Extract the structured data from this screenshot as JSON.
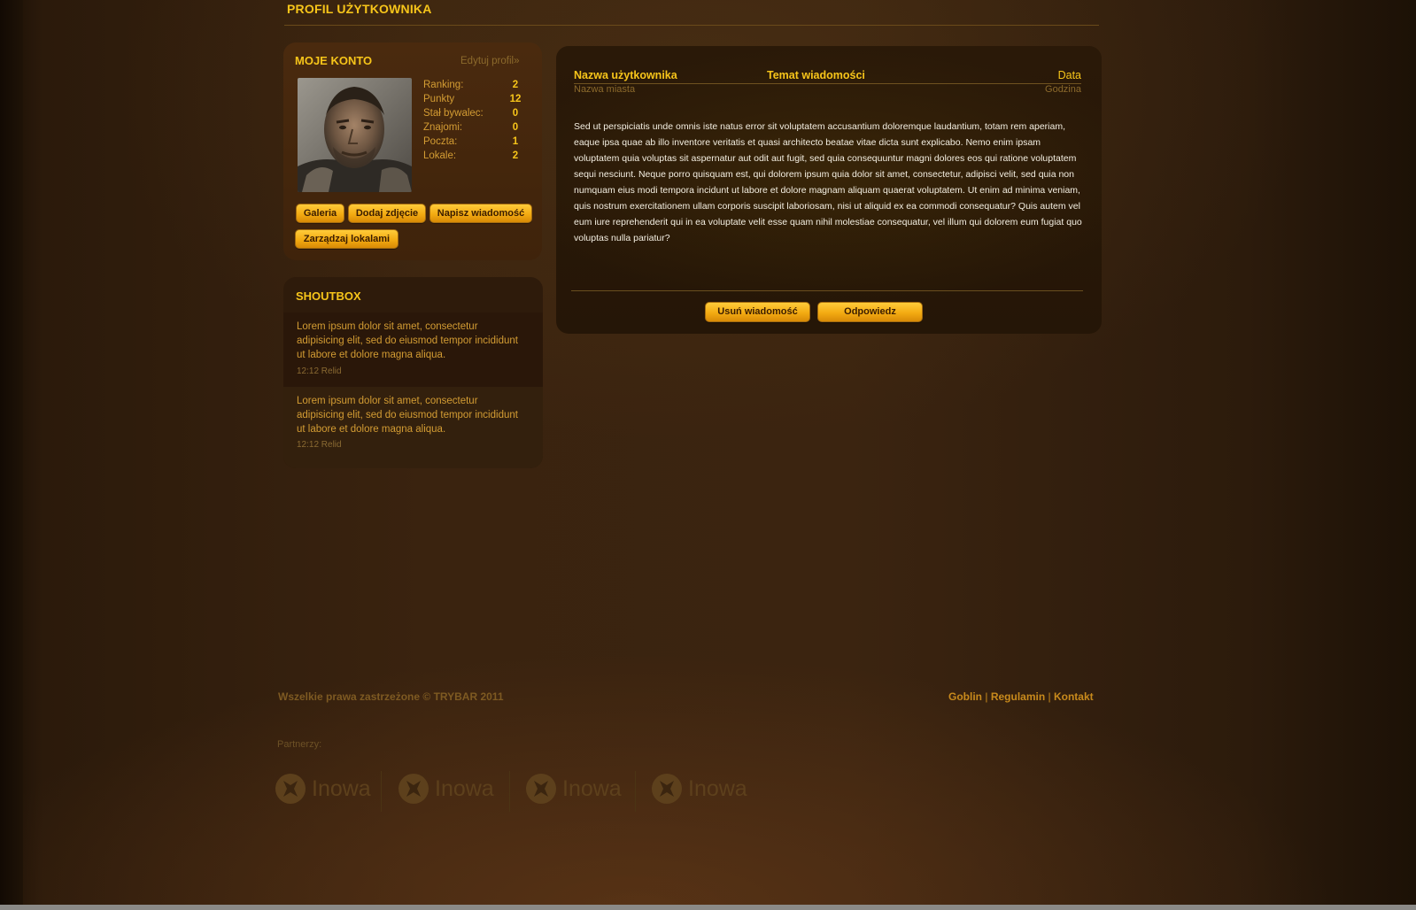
{
  "header": {
    "title": "PROFIL UŻYTKOWNIKA"
  },
  "account": {
    "heading": "MOJE KONTO",
    "edit_link": "Edytuj profil»",
    "avatar": "avatar-photo",
    "stats": [
      {
        "label": "Ranking:",
        "value": "2"
      },
      {
        "label": "Punkty",
        "value": "12"
      },
      {
        "label": "Stał bywalec:",
        "value": "0"
      },
      {
        "label": "Znajomi:",
        "value": "0"
      },
      {
        "label": "Poczta:",
        "value": "1"
      },
      {
        "label": "Lokale:",
        "value": "2"
      }
    ],
    "buttons": {
      "gallery": "Galeria",
      "add_photo": "Dodaj zdjęcie",
      "write_message": "Napisz wiadomość",
      "manage_venues": "Zarządzaj lokalami"
    }
  },
  "shoutbox": {
    "heading": "SHOUTBOX",
    "items": [
      {
        "text": "Lorem ipsum dolor sit amet, consectetur adipisicing elit, sed do eiusmod tempor incididunt ut labore et dolore magna aliqua.",
        "meta": "12:12 Relid"
      },
      {
        "text": "Lorem ipsum dolor sit amet, consectetur adipisicing elit, sed do eiusmod tempor incididunt ut labore et dolore magna aliqua.",
        "meta": "12:12 Relid"
      }
    ]
  },
  "message": {
    "username": "Nazwa użytkownika",
    "subject": "Temat wiadomości",
    "date": "Data",
    "city": "Nazwa miasta",
    "time": "Godzina",
    "body": "Sed ut perspiciatis unde omnis iste natus error sit voluptatem accusantium doloremque laudantium, totam rem aperiam, eaque ipsa quae ab illo inventore veritatis et quasi architecto beatae vitae dicta sunt explicabo. Nemo enim ipsam voluptatem quia voluptas sit aspernatur aut odit aut fugit, sed quia consequuntur magni dolores eos qui ratione voluptatem sequi nesciunt. Neque porro quisquam est, qui dolorem ipsum quia dolor sit amet, consectetur, adipisci velit, sed quia non numquam eius modi tempora incidunt ut labore et dolore magnam aliquam quaerat voluptatem. Ut enim ad minima veniam, quis nostrum exercitationem ullam corporis suscipit laboriosam, nisi ut aliquid ex ea commodi consequatur? Quis autem vel eum iure reprehenderit qui in ea voluptate velit esse quam nihil molestiae consequatur, vel illum qui dolorem eum fugiat quo voluptas nulla pariatur?",
    "delete_button": "Usuń wiadomość",
    "reply_button": "Odpowiedz"
  },
  "footer": {
    "copyright": "Wszelkie prawa zastrzeżone © TRYBAR 2011",
    "links": [
      "Goblin",
      "Regulamin",
      "Kontakt"
    ],
    "separator": "|",
    "partners_label": "Partnerzy:",
    "partner_logos": [
      {
        "name": "Inowa",
        "icon": "inowa-logo-icon"
      },
      {
        "name": "Inowa",
        "icon": "inowa-logo-icon"
      },
      {
        "name": "Inowa",
        "icon": "inowa-logo-icon"
      },
      {
        "name": "Inowa",
        "icon": "inowa-logo-icon"
      }
    ]
  },
  "colors": {
    "accent": "#f7c51a",
    "label": "#d39c33",
    "button": "#f3ab12",
    "background": "#3a230f"
  }
}
